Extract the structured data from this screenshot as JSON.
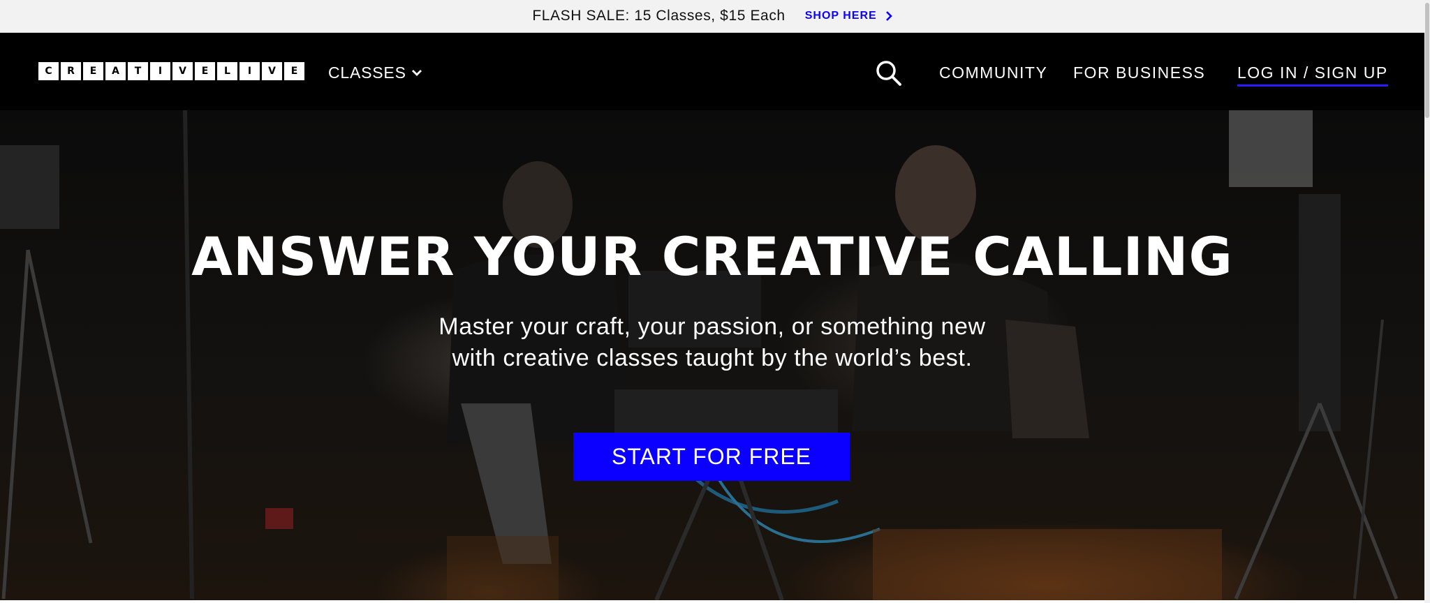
{
  "promo": {
    "text": "FLASH SALE: 15 Classes, $15 Each",
    "link_label": "SHOP HERE",
    "link_color": "#0c00ff"
  },
  "header": {
    "logo_letters": [
      "C",
      "R",
      "E",
      "A",
      "T",
      "I",
      "V",
      "E",
      "L",
      "I",
      "V",
      "E"
    ],
    "classes_label": "CLASSES",
    "community_label": "COMMUNITY",
    "business_label": "FOR BUSINESS",
    "login_label": "LOG IN / SIGN UP"
  },
  "hero": {
    "title": "ANSWER YOUR CREATIVE CALLING",
    "subtitle_line1": "Master your craft, your passion, or something new",
    "subtitle_line2": "with creative classes taught by the world’s best.",
    "cta_label": "START FOR FREE",
    "cta_color": "#0b00ff"
  },
  "icons": {
    "search": "search-icon",
    "classes_dropdown": "chevron-down-icon",
    "promo_arrow": "chevron-right-icon"
  }
}
